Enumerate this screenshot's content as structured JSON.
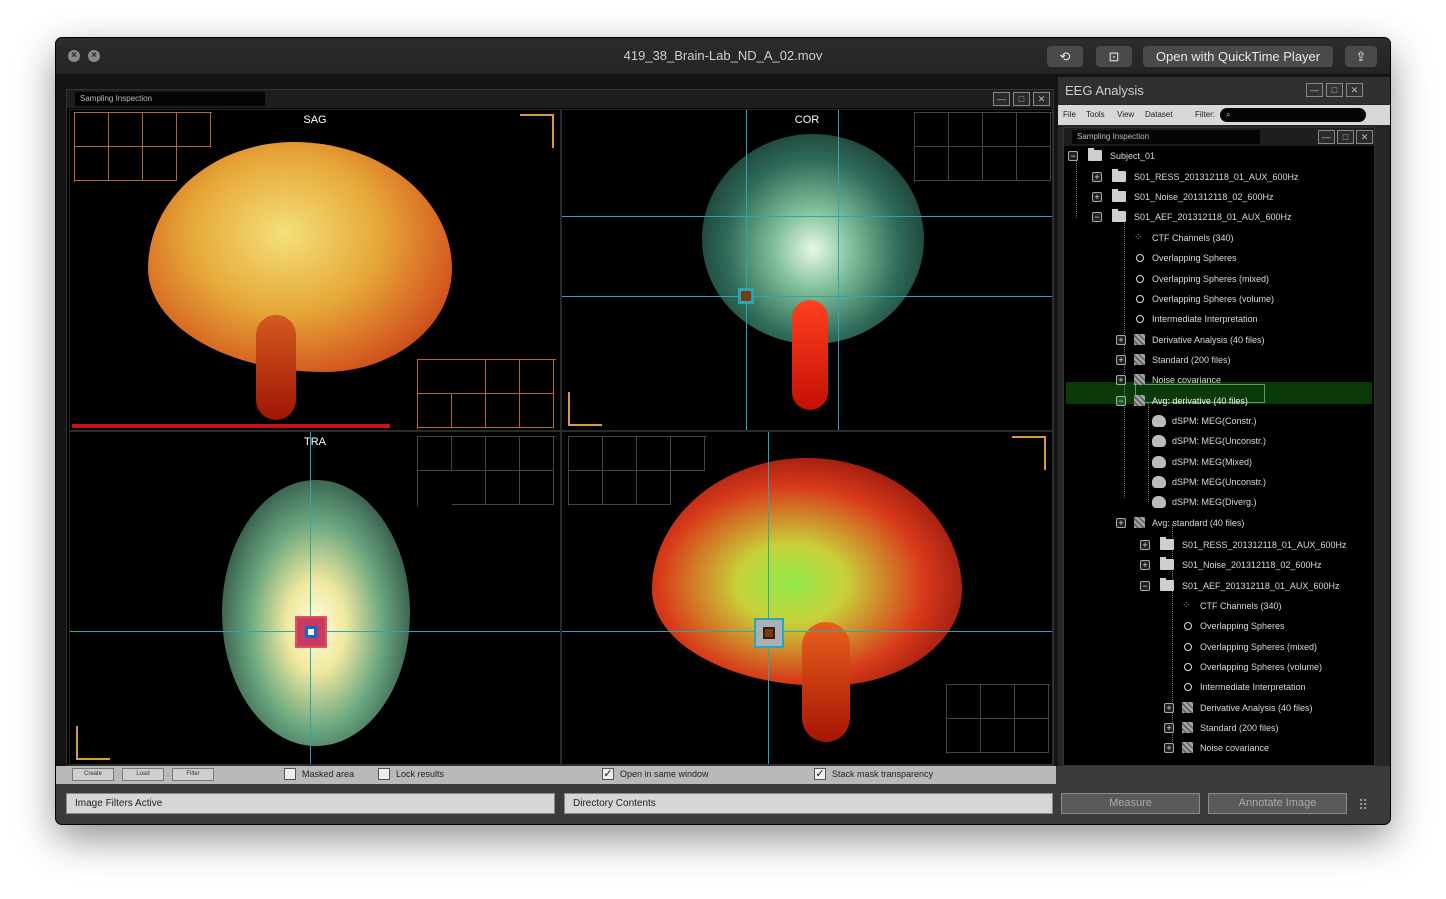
{
  "window": {
    "title": "419_38_Brain-Lab_ND_A_02.mov",
    "open_button": "Open with QuickTime Player"
  },
  "viewer": {
    "title": "Sampling Inspection",
    "views": {
      "sag": "SAG",
      "cor": "COR",
      "tra": "TRA"
    }
  },
  "panel": {
    "title": "EEG Analysis",
    "menu": [
      "File",
      "Tools",
      "View",
      "Dataset"
    ],
    "filter_label": "Filter:",
    "filter_value": "",
    "subpanel_title": "Sampling Inspection",
    "tree": [
      "Subject_01",
      "S01_RESS_201312118_01_AUX_600Hz",
      "S01_Noise_201312118_02_600Hz",
      "S01_AEF_201312118_01_AUX_600Hz",
      "CTF Channels (340)",
      "Overlapping Spheres",
      "Overlapping Spheres (mixed)",
      "Overlapping Spheres (volume)",
      "Intermediate Interpretation",
      "Derivative Analysis (40 files)",
      "Standard (200 files)",
      "Noise covariance",
      "Avg: derivative (40 files)",
      "dSPM: MEG(Constr.)",
      "dSPM: MEG(Unconstr.)",
      "dSPM: MEG(Mixed)",
      "dSPM: MEG(Unconstr.)",
      "dSPM: MEG(Diverg.)",
      "Avg: standard (40 files)",
      "S01_RESS_201312118_01_AUX_600Hz",
      "S01_Noise_201312118_02_600Hz",
      "S01_AEF_201312118_01_AUX_600Hz",
      "CTF Channels (340)",
      "Overlapping Spheres",
      "Overlapping Spheres (mixed)",
      "Overlapping Spheres (volume)",
      "Intermediate Interpretation",
      "Derivative Analysis (40 files)",
      "Standard (200 files)",
      "Noise covariance"
    ]
  },
  "controls": {
    "create": "Create",
    "load": "Load",
    "filter": "Filter",
    "masked_area": "Masked area",
    "lock_results": "Lock results",
    "open_same_window": "Open in same window",
    "stack_mask": "Stack mask transparency"
  },
  "status": {
    "image_filters": "Image Filters Active",
    "directory": "Directory Contents",
    "measure": "Measure",
    "annotate": "Annotate Image"
  },
  "colors": {
    "accent_teal": "#2aa7b4",
    "orange_grid": "#b0673a",
    "selection": "#0a3a0a"
  }
}
